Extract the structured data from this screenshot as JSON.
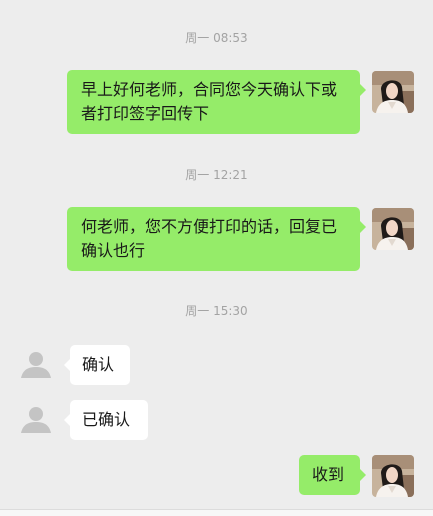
{
  "colors": {
    "background": "#ededed",
    "outgoing_bubble": "#95ec69",
    "incoming_bubble": "#ffffff",
    "timestamp_text": "#a3a3a3"
  },
  "messages": [
    {
      "type": "time",
      "text": "周一 08:53"
    },
    {
      "type": "outgoing",
      "text": "早上好何老师，合同您今天确认下或者打印签字回传下",
      "avatar": "photo-avatar-icon"
    },
    {
      "type": "time",
      "text": "周一 12:21"
    },
    {
      "type": "outgoing",
      "text": "何老师，您不方便打印的话，回复已确认也行",
      "avatar": "photo-avatar-icon"
    },
    {
      "type": "time",
      "text": "周一 15:30"
    },
    {
      "type": "incoming",
      "text": "确认",
      "avatar": "default-user-icon"
    },
    {
      "type": "incoming",
      "text": "已确认",
      "avatar": "default-user-icon"
    },
    {
      "type": "outgoing",
      "text": "收到",
      "avatar": "photo-avatar-icon"
    }
  ]
}
